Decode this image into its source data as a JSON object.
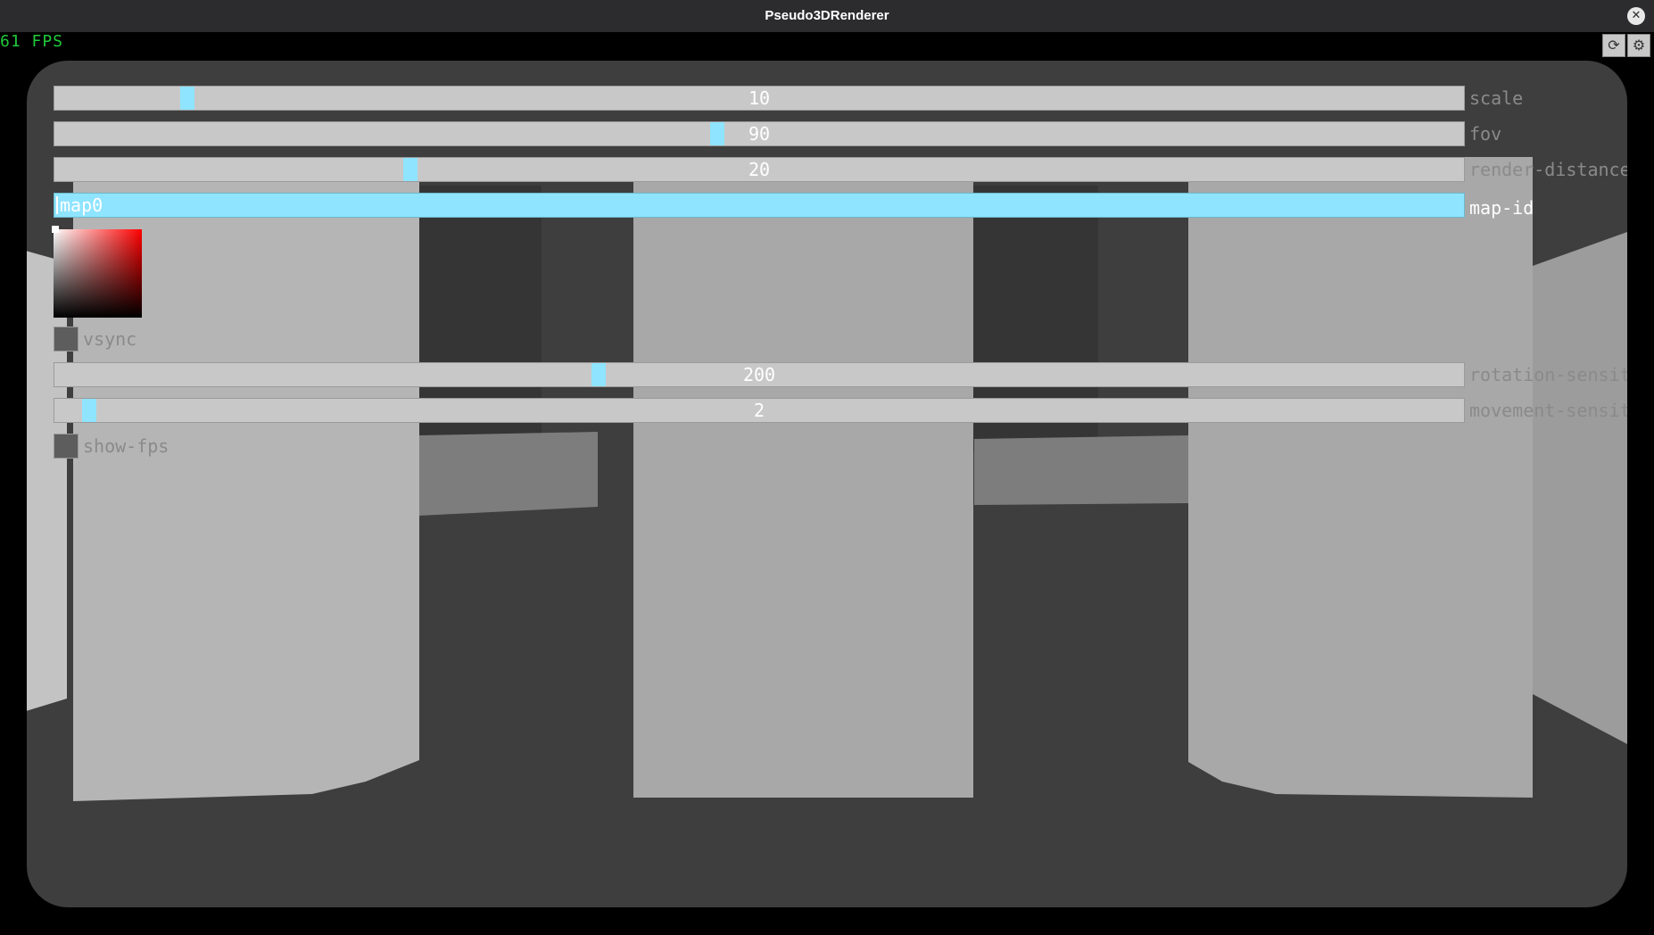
{
  "window": {
    "title": "Pseudo3DRenderer"
  },
  "overlay": {
    "fps_text": "61 FPS"
  },
  "controls": {
    "scale": {
      "label": "scale",
      "value": "10",
      "position": 0.09
    },
    "fov": {
      "label": "fov",
      "value": "90",
      "position": 0.47
    },
    "render_distance": {
      "label": "render-distance",
      "value": "20",
      "position": 0.25
    },
    "map_id": {
      "label": "map-id",
      "value": "map0"
    },
    "vsync": {
      "label": "vsync",
      "checked": false
    },
    "rotation_sensitivity": {
      "label": "rotation-sensitivity",
      "value": "200",
      "position": 0.385
    },
    "movement_sensitivity": {
      "label": "movement-sensitivit",
      "value": "2",
      "position": 0.02
    },
    "show_fps": {
      "label": "show-fps",
      "checked": false
    }
  },
  "colors": {
    "accent": "#8fe4ff",
    "fps_text": "#21c93a",
    "panel_bg": "#3e3e3e",
    "slider_bg": "#c8c8c8"
  }
}
